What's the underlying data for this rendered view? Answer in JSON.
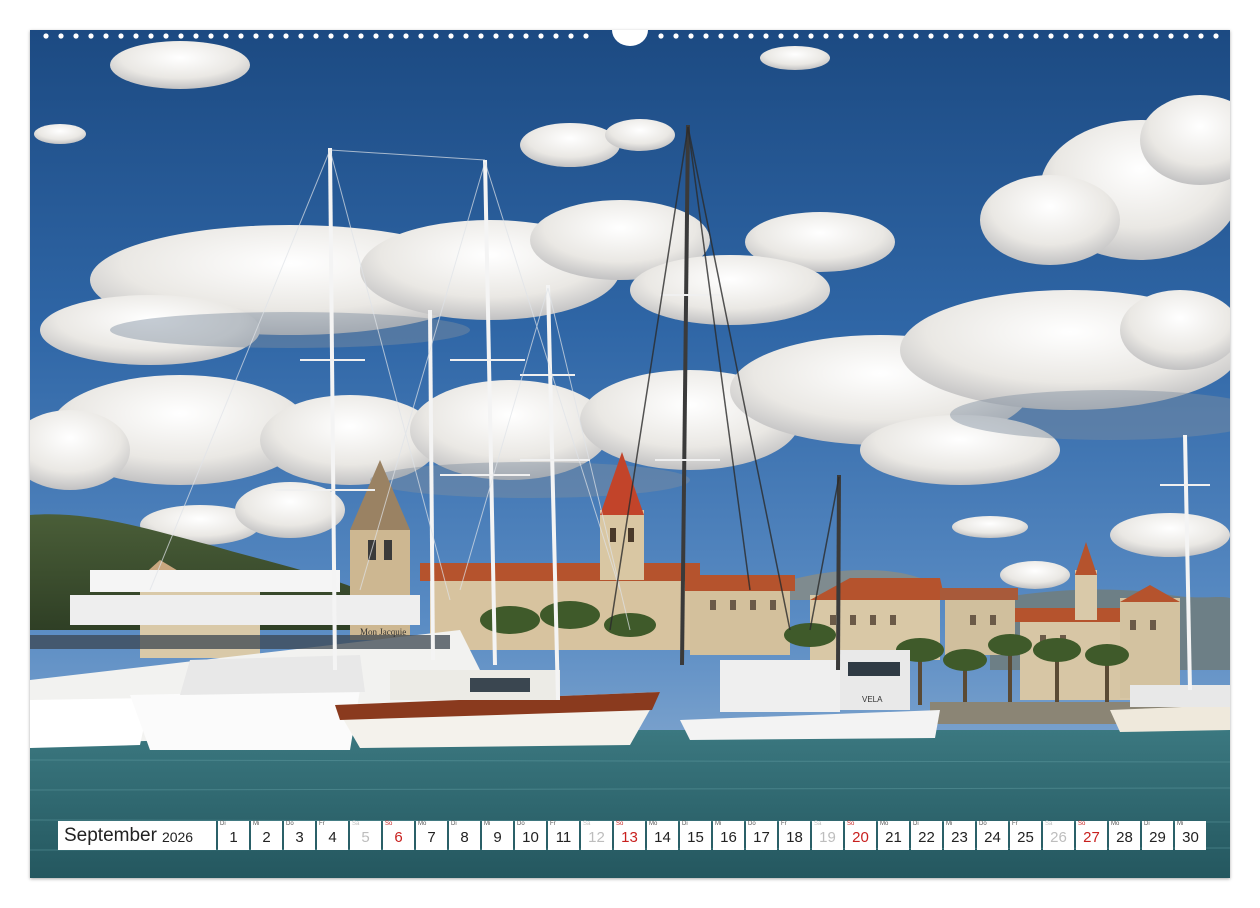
{
  "calendar": {
    "month": "September",
    "year": "2026",
    "days": [
      {
        "wd": "Di",
        "n": "1",
        "kind": "weekday"
      },
      {
        "wd": "Mi",
        "n": "2",
        "kind": "weekday"
      },
      {
        "wd": "Do",
        "n": "3",
        "kind": "weekday"
      },
      {
        "wd": "Fr",
        "n": "4",
        "kind": "weekday"
      },
      {
        "wd": "Sa",
        "n": "5",
        "kind": "sat"
      },
      {
        "wd": "So",
        "n": "6",
        "kind": "sun"
      },
      {
        "wd": "Mo",
        "n": "7",
        "kind": "weekday"
      },
      {
        "wd": "Di",
        "n": "8",
        "kind": "weekday"
      },
      {
        "wd": "Mi",
        "n": "9",
        "kind": "weekday"
      },
      {
        "wd": "Do",
        "n": "10",
        "kind": "weekday"
      },
      {
        "wd": "Fr",
        "n": "11",
        "kind": "weekday"
      },
      {
        "wd": "Sa",
        "n": "12",
        "kind": "sat"
      },
      {
        "wd": "So",
        "n": "13",
        "kind": "sun"
      },
      {
        "wd": "Mo",
        "n": "14",
        "kind": "weekday"
      },
      {
        "wd": "Di",
        "n": "15",
        "kind": "weekday"
      },
      {
        "wd": "Mi",
        "n": "16",
        "kind": "weekday"
      },
      {
        "wd": "Do",
        "n": "17",
        "kind": "weekday"
      },
      {
        "wd": "Fr",
        "n": "18",
        "kind": "weekday"
      },
      {
        "wd": "Sa",
        "n": "19",
        "kind": "sat"
      },
      {
        "wd": "So",
        "n": "20",
        "kind": "sun"
      },
      {
        "wd": "Mo",
        "n": "21",
        "kind": "weekday"
      },
      {
        "wd": "Di",
        "n": "22",
        "kind": "weekday"
      },
      {
        "wd": "Mi",
        "n": "23",
        "kind": "weekday"
      },
      {
        "wd": "Do",
        "n": "24",
        "kind": "weekday"
      },
      {
        "wd": "Fr",
        "n": "25",
        "kind": "weekday"
      },
      {
        "wd": "Sa",
        "n": "26",
        "kind": "sat"
      },
      {
        "wd": "So",
        "n": "27",
        "kind": "sun"
      },
      {
        "wd": "Mo",
        "n": "28",
        "kind": "weekday"
      },
      {
        "wd": "Di",
        "n": "29",
        "kind": "weekday"
      },
      {
        "wd": "Mi",
        "n": "30",
        "kind": "weekday"
      }
    ]
  },
  "photo": {
    "subject": "Harbour with sailing yachts in front of an old town waterfront",
    "yacht_names": [
      "Mon Jacquie",
      "VELA"
    ]
  },
  "colors": {
    "sky_top": "#1f4e86",
    "sky_mid": "#3f7bb8",
    "sea": "#2d6a73",
    "roof": "#b5532d",
    "sunday_text": "#c8201e",
    "saturday_text": "#bdbdbd"
  },
  "icons": [
    "wire-binding-icon",
    "hanger-hole-icon"
  ]
}
